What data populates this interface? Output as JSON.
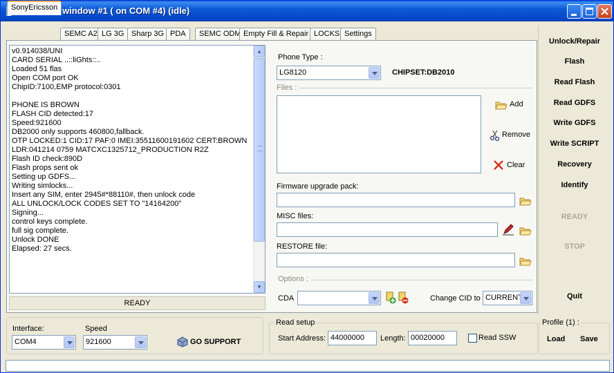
{
  "window": {
    "title": "v0.914038 window #1 ( on COM #4) (idle)"
  },
  "tabs": [
    {
      "label": "SonyEricsson",
      "active": true
    },
    {
      "label": "SEMC A2"
    },
    {
      "label": "LG 3G"
    },
    {
      "label": "Sharp 3G"
    },
    {
      "label": "PDA"
    },
    {
      "label": "SEMC ODM"
    },
    {
      "label": "Empty Fill & Repair"
    },
    {
      "label": "LOCKS"
    },
    {
      "label": "Settings"
    }
  ],
  "log": {
    "lines": [
      "v0.914038/UNI",
      "CARD SERIAL ..::liGhts::..",
      "Loaded 51 flas",
      "Open COM port OK",
      "ChipID:7100,EMP protocol:0301",
      "",
      "PHONE IS BROWN",
      "FLASH CID detected:17",
      "Speed:921600",
      "DB2000 only supports 460800,fallback.",
      "OTP LOCKED:1 CID:17 PAF:0 IMEI:35511600191602 CERT:BROWN",
      "LDR:041214 0759 MATCXC1325712_PRODUCTION R2Z",
      "Flash ID check:890D",
      "Flash props sent ok",
      "Setting up GDFS...",
      "Writing simlocks...",
      "Insert any SIM, enter 2945#*88110#, then unlock code",
      "ALL UNLOCK/LOCK CODES SET TO \"14164200\"",
      "Signing...",
      "control keys complete.",
      "full sig complete.",
      "Unlock DONE",
      "Elapsed: 27 secs."
    ],
    "status": "READY"
  },
  "phone": {
    "type_label": "Phone Type :",
    "type_value": "LG8120",
    "chipset": "CHIPSET:DB2010"
  },
  "files": {
    "label": "Files :",
    "add": "Add",
    "remove": "Remove",
    "clear": "Clear"
  },
  "firmware": {
    "label": "Firmware upgrade pack:",
    "value": ""
  },
  "misc": {
    "label": "MISC files:",
    "value": ""
  },
  "restore": {
    "label": "RESTORE file:",
    "value": ""
  },
  "options": {
    "label": "Options :",
    "cda_label": "CDA",
    "cda_value": "",
    "change_cid_label": "Change CID to",
    "change_cid_value": "CURRENT"
  },
  "side_buttons": {
    "unlock": "Unlock/Repair",
    "flash": "Flash",
    "read_flash": "Read Flash",
    "read_gdfs": "Read GDFS",
    "write_gdfs": "Write GDFS",
    "write_script": "Write SCRIPT",
    "recovery": "Recovery",
    "identify": "Identify",
    "ready": "READY",
    "stop": "STOP",
    "quit": "Quit"
  },
  "connection": {
    "interface_label": "Interface:",
    "interface_value": "COM4",
    "speed_label": "Speed",
    "speed_value": "921600",
    "go_support": "GO SUPPORT"
  },
  "read_setup": {
    "label": "Read setup",
    "start_label": "Start Address:",
    "start_value": "44000000",
    "length_label": "Length:",
    "length_value": "00020000",
    "read_ssw": "Read SSW"
  },
  "profile": {
    "label": "Profile (1) :",
    "load": "Load",
    "save": "Save"
  }
}
